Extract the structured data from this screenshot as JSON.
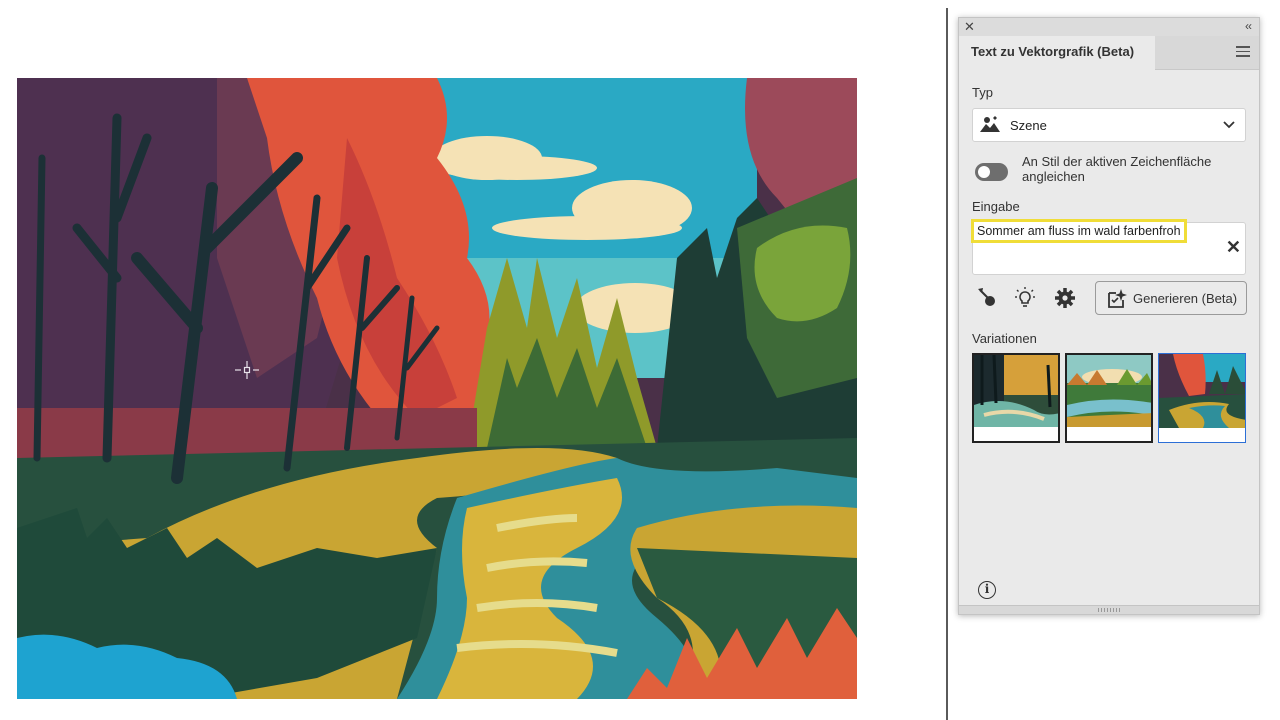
{
  "panel": {
    "title": "Text zu Vektorgrafik (Beta)",
    "type_label": "Typ",
    "type_value": "Szene",
    "type_icon": "scene-icon",
    "match_style_label": "An Stil der aktiven Zeichenfläche angleichen",
    "match_style_on": false,
    "prompt_label": "Eingabe",
    "prompt_value": "Sommer am fluss im wald farbenfroh",
    "generate_label": "Generieren (Beta)",
    "variations_label": "Variationen",
    "variations_count": 3,
    "selected_variation": 3
  },
  "colors": {
    "highlight": "#f0dd38",
    "selection": "#2c6fd6",
    "panel_bg": "#eaeaea"
  }
}
